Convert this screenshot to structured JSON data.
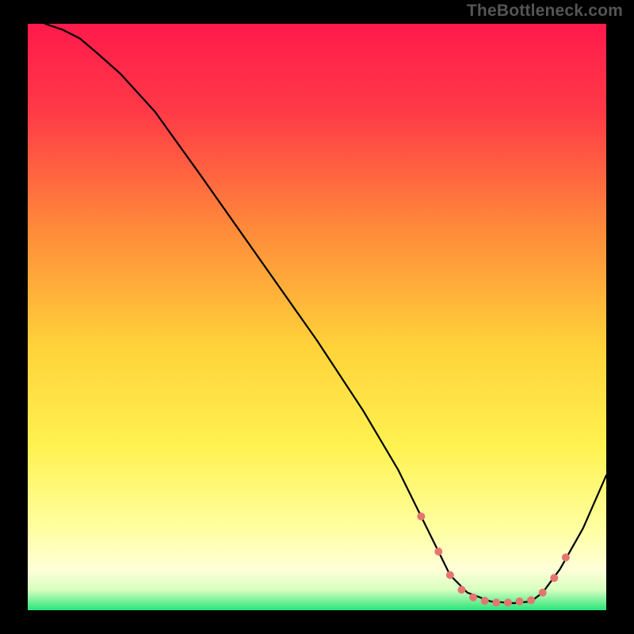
{
  "watermark": "TheBottleneck.com",
  "chart_data": {
    "type": "line",
    "title": "",
    "xlabel": "",
    "ylabel": "",
    "xlim": [
      0,
      100
    ],
    "ylim": [
      0,
      100
    ],
    "grid": false,
    "background_gradient": {
      "stops": [
        {
          "offset": 0.0,
          "color": "#ff1a4b"
        },
        {
          "offset": 0.15,
          "color": "#ff3a47"
        },
        {
          "offset": 0.35,
          "color": "#ff8a3a"
        },
        {
          "offset": 0.55,
          "color": "#ffd23a"
        },
        {
          "offset": 0.72,
          "color": "#fff250"
        },
        {
          "offset": 0.86,
          "color": "#ffffa0"
        },
        {
          "offset": 0.93,
          "color": "#ffffd8"
        },
        {
          "offset": 0.965,
          "color": "#d8ffc0"
        },
        {
          "offset": 1.0,
          "color": "#28e47a"
        }
      ]
    },
    "series": [
      {
        "name": "curve",
        "type": "line",
        "color": "#000000",
        "x": [
          3,
          6,
          9,
          12,
          16,
          22,
          30,
          40,
          50,
          58,
          64,
          68,
          71,
          73,
          76,
          80,
          84,
          87,
          89,
          92,
          96,
          100
        ],
        "y": [
          100,
          99,
          97.5,
          95,
          91.5,
          85,
          74,
          60,
          46,
          34,
          24,
          16,
          10,
          6,
          3,
          1.5,
          1.2,
          1.5,
          3,
          7,
          14,
          23
        ]
      },
      {
        "name": "highlight-dots",
        "type": "scatter",
        "color": "#e5766f",
        "x": [
          68,
          71,
          73,
          75,
          77,
          79,
          81,
          83,
          85,
          87,
          89,
          91,
          93
        ],
        "y": [
          16,
          10,
          6,
          3.5,
          2.2,
          1.6,
          1.3,
          1.3,
          1.5,
          1.7,
          3,
          5.5,
          9
        ]
      }
    ]
  }
}
